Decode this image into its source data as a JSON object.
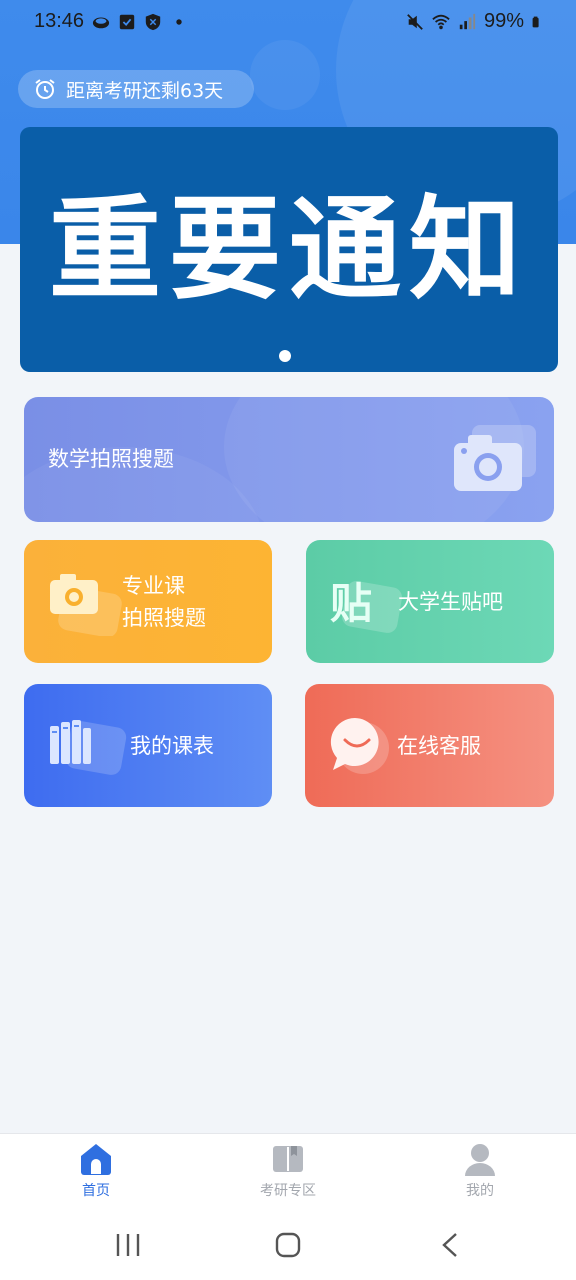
{
  "status_bar": {
    "time": "13:46",
    "battery": "99%",
    "left_icons": [
      "cloud-icon",
      "check-icon",
      "shield-icon",
      "dot-icon"
    ],
    "right_icons": [
      "mute-icon",
      "wifi-icon",
      "signal-icon",
      "battery-icon"
    ]
  },
  "countdown": {
    "text": "距离考研还剩63天"
  },
  "banner": {
    "title": "重要通知",
    "page_count": 1,
    "active_page": 1
  },
  "cards": {
    "math": "数学拍照搜题",
    "major_line1": "专业课",
    "major_line2": "拍照搜题",
    "tieba": "大学生贴吧",
    "tieba_icon_char": "贴",
    "schedule": "我的课表",
    "service": "在线客服"
  },
  "bottom_nav": {
    "items": [
      {
        "label": "首页",
        "icon": "home-icon",
        "active": true
      },
      {
        "label": "考研专区",
        "icon": "book-icon",
        "active": false
      },
      {
        "label": "我的",
        "icon": "user-icon",
        "active": false
      }
    ]
  },
  "colors": {
    "accent": "#2f6fe0",
    "banner_bg": "#0a5ea8",
    "math_card": "#7a8fe6",
    "major_card": "#fbb13a",
    "tieba_card": "#5ccca6",
    "schedule_card": "#3e6cf0",
    "service_card": "#ef6b57"
  }
}
